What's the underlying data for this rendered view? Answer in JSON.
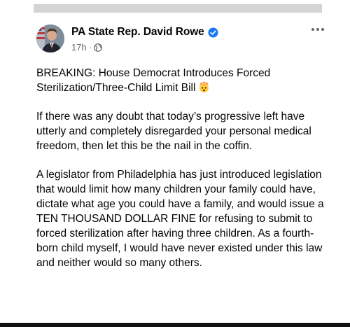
{
  "post": {
    "author": "PA State Rep. David Rowe",
    "time": "17h",
    "separator": "·",
    "headline": "BREAKING: House Democrat Introduces Forced Sterilization/Three-Child Limit Bill",
    "paragraphs": [
      "If there was any doubt that today’s progressive left have utterly and completely disregarded your personal medical freedom, then let this be the nail in the coffin.",
      "A legislator from Philadelphia has just introduced legislation that would limit how many children your family could have, dictate what age you could have a family, and would issue a TEN THOUSAND DOLLAR FINE for refusing to submit to forced sterilization after having three children. As a fourth-born child myself, I would have never existed under this law and neither would so many others."
    ]
  },
  "icons": {
    "verified": "verified-badge-icon",
    "audience": "globe-icon",
    "menu": "more-options-icon",
    "emoji": "exploding-head-emoji-icon"
  },
  "colors": {
    "text": "#050505",
    "meta": "#65676b",
    "verified": "#1877f2"
  }
}
